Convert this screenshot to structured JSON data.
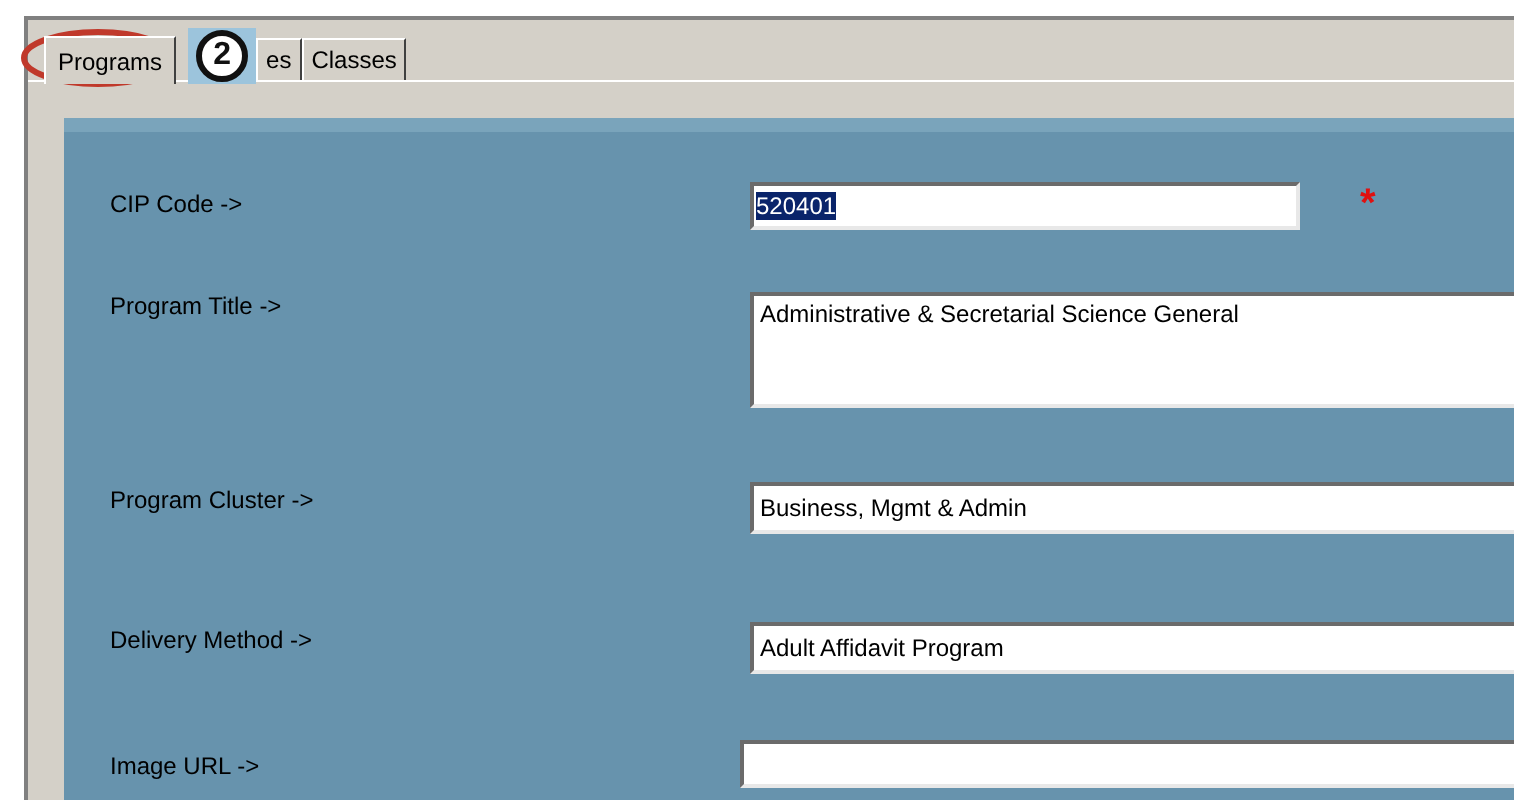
{
  "tabs": [
    {
      "label": "Programs",
      "selected": true
    },
    {
      "label": "es",
      "selected": false
    },
    {
      "label": "Classes",
      "selected": false
    }
  ],
  "callout": {
    "number": "2"
  },
  "fields": [
    {
      "label": "CIP Code ->",
      "value": "520401",
      "kind": "short",
      "text_selected": true,
      "required_mark": "*"
    },
    {
      "label": "Program Title ->",
      "value": "Administrative & Secretarial Science General",
      "kind": "multiline"
    },
    {
      "label": "Program Cluster ->",
      "value": "Business, Mgmt & Admin",
      "kind": "wide"
    },
    {
      "label": "Delivery Method ->",
      "value": "Adult Affidavit Program",
      "kind": "wide"
    },
    {
      "label": "Image URL ->",
      "kind": "url"
    }
  ]
}
